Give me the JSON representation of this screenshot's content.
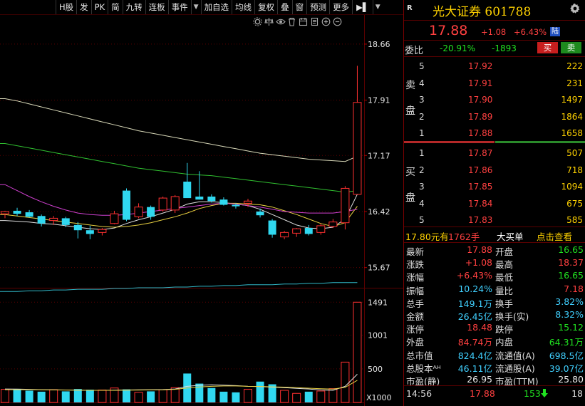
{
  "toolbar": {
    "items": [
      "H股",
      "发",
      "PK",
      "简",
      "九转",
      "连板",
      "事件",
      "",
      "加自选",
      "均线",
      "复权",
      "叠",
      "窗",
      "预测",
      "更多"
    ],
    "tab_arrow": "▶▌",
    "menu_arrow": "▼"
  },
  "chart_tools": [
    "settings-icon",
    "scale-icon",
    "eye-icon",
    "trash-icon",
    "calendar-icon",
    "doc-icon",
    "zoom-in-icon",
    "zoom-out-icon"
  ],
  "chart_data": {
    "type": "candlestick",
    "price_axis": {
      "ticks": [
        18.66,
        17.91,
        17.17,
        16.42,
        15.67
      ],
      "range": [
        15.4,
        19.05
      ]
    },
    "volume_axis": {
      "ticks": [
        1491,
        1001,
        500
      ],
      "unit": "X1000",
      "max": 1600
    },
    "candles": [
      {
        "o": 16.39,
        "h": 16.43,
        "l": 16.33,
        "c": 16.42
      },
      {
        "o": 16.43,
        "h": 16.47,
        "l": 16.36,
        "c": 16.39
      },
      {
        "o": 16.41,
        "h": 16.44,
        "l": 16.34,
        "c": 16.35
      },
      {
        "o": 16.36,
        "h": 16.38,
        "l": 16.22,
        "c": 16.26
      },
      {
        "o": 16.3,
        "h": 16.36,
        "l": 16.24,
        "c": 16.33
      },
      {
        "o": 16.33,
        "h": 16.35,
        "l": 16.21,
        "c": 16.24
      },
      {
        "o": 16.24,
        "h": 16.28,
        "l": 16.06,
        "c": 16.17
      },
      {
        "o": 16.17,
        "h": 16.23,
        "l": 16.05,
        "c": 16.12
      },
      {
        "o": 16.14,
        "h": 16.2,
        "l": 16.1,
        "c": 16.18
      },
      {
        "o": 16.26,
        "h": 16.43,
        "l": 16.25,
        "c": 16.39
      },
      {
        "o": 16.7,
        "h": 16.73,
        "l": 16.29,
        "c": 16.31
      },
      {
        "o": 16.35,
        "h": 16.53,
        "l": 16.33,
        "c": 16.48
      },
      {
        "o": 16.48,
        "h": 16.5,
        "l": 16.31,
        "c": 16.35
      },
      {
        "o": 16.44,
        "h": 16.62,
        "l": 16.42,
        "c": 16.6
      },
      {
        "o": 16.44,
        "h": 16.64,
        "l": 16.4,
        "c": 16.62
      },
      {
        "o": 16.82,
        "h": 17.07,
        "l": 16.68,
        "c": 16.6
      },
      {
        "o": 16.62,
        "h": 16.96,
        "l": 16.58,
        "c": 16.58
      },
      {
        "o": 16.62,
        "h": 16.65,
        "l": 16.54,
        "c": 16.56
      },
      {
        "o": 16.58,
        "h": 16.61,
        "l": 16.5,
        "c": 16.51
      },
      {
        "o": 16.51,
        "h": 16.53,
        "l": 16.46,
        "c": 16.49
      },
      {
        "o": 16.53,
        "h": 16.59,
        "l": 16.48,
        "c": 16.56
      },
      {
        "o": 16.42,
        "h": 16.46,
        "l": 16.34,
        "c": 16.37
      },
      {
        "o": 16.3,
        "h": 16.32,
        "l": 16.07,
        "c": 16.11
      },
      {
        "o": 16.08,
        "h": 16.16,
        "l": 16.05,
        "c": 16.14
      },
      {
        "o": 16.13,
        "h": 16.2,
        "l": 16.08,
        "c": 16.19
      },
      {
        "o": 16.2,
        "h": 16.24,
        "l": 16.1,
        "c": 16.12
      },
      {
        "o": 16.14,
        "h": 16.26,
        "l": 16.11,
        "c": 16.23
      },
      {
        "o": 16.22,
        "h": 16.32,
        "l": 16.2,
        "c": 16.28
      },
      {
        "o": 16.27,
        "h": 16.76,
        "l": 16.18,
        "c": 16.73
      },
      {
        "o": 16.65,
        "h": 18.37,
        "l": 16.65,
        "c": 17.88
      }
    ],
    "volumes": [
      195,
      200,
      175,
      160,
      190,
      165,
      200,
      190,
      185,
      215,
      195,
      150,
      165,
      190,
      220,
      430,
      280,
      215,
      160,
      150,
      195,
      310,
      270,
      180,
      135,
      160,
      170,
      205,
      600,
      1491
    ],
    "ma": [
      {
        "name": "white",
        "color": "#e0e0e0",
        "values": [
          16.3,
          16.29,
          16.28,
          16.26,
          16.25,
          16.23,
          16.21,
          16.19,
          16.18,
          16.2,
          16.26,
          16.31,
          16.35,
          16.4,
          16.45,
          16.52,
          16.55,
          16.55,
          16.54,
          16.52,
          16.5,
          16.45,
          16.38,
          16.31,
          16.24,
          16.2,
          16.19,
          16.21,
          16.32,
          16.65
        ]
      },
      {
        "name": "yellow",
        "color": "#e8d040",
        "values": [
          16.38,
          16.36,
          16.34,
          16.32,
          16.3,
          16.28,
          16.26,
          16.24,
          16.22,
          16.21,
          16.22,
          16.24,
          16.27,
          16.31,
          16.35,
          16.4,
          16.46,
          16.5,
          16.53,
          16.53,
          16.52,
          16.51,
          16.48,
          16.43,
          16.38,
          16.32,
          16.26,
          16.22,
          16.27,
          16.49
        ]
      },
      {
        "name": "magenta",
        "color": "#d040d0",
        "values": [
          16.78,
          16.7,
          16.62,
          16.55,
          16.49,
          16.44,
          16.4,
          16.38,
          16.37,
          16.37,
          16.38,
          16.4,
          16.42,
          16.44,
          16.46,
          16.48,
          16.5,
          16.52,
          16.53,
          16.52,
          16.5,
          16.48,
          16.45,
          16.42,
          16.41,
          16.4,
          16.4,
          16.4,
          16.42,
          16.45
        ]
      },
      {
        "name": "green",
        "color": "#30c030",
        "values": [
          17.33,
          17.3,
          17.27,
          17.24,
          17.21,
          17.18,
          17.15,
          17.12,
          17.09,
          17.06,
          17.03,
          17.0,
          16.98,
          16.96,
          16.94,
          16.92,
          16.91,
          16.9,
          16.88,
          16.86,
          16.84,
          16.82,
          16.8,
          16.78,
          16.76,
          16.74,
          16.72,
          16.7,
          16.68,
          16.7
        ]
      },
      {
        "name": "cream",
        "color": "#d8d8b8",
        "values": [
          17.93,
          17.9,
          17.86,
          17.82,
          17.78,
          17.74,
          17.7,
          17.66,
          17.62,
          17.58,
          17.54,
          17.5,
          17.47,
          17.44,
          17.41,
          17.38,
          17.35,
          17.32,
          17.29,
          17.26,
          17.23,
          17.2,
          17.18,
          17.16,
          17.14,
          17.12,
          17.11,
          17.1,
          17.09,
          17.16
        ]
      },
      {
        "name": "cyan",
        "color": "#30b8c8",
        "values": [
          15.35,
          15.35,
          15.36,
          15.36,
          15.37,
          15.37,
          15.38,
          15.38,
          15.38,
          15.39,
          15.39,
          15.4,
          15.4,
          15.4,
          15.41,
          15.41,
          15.42,
          15.42,
          15.43,
          15.43,
          15.44,
          15.44,
          15.44,
          15.45,
          15.45,
          15.46,
          15.46,
          15.47,
          15.47,
          15.47
        ]
      }
    ],
    "vol_ma": [
      {
        "color": "#e0e0e0",
        "values": [
          200,
          198,
          195,
          190,
          188,
          185,
          182,
          180,
          180,
          182,
          185,
          188,
          190,
          192,
          200,
          240,
          255,
          262,
          258,
          250,
          240,
          235,
          228,
          220,
          210,
          200,
          185,
          180,
          240,
          420
        ]
      },
      {
        "color": "#e8d040",
        "values": [
          190,
          190,
          190,
          188,
          186,
          184,
          182,
          180,
          180,
          180,
          182,
          184,
          186,
          188,
          195,
          215,
          230,
          240,
          245,
          245,
          240,
          238,
          232,
          228,
          220,
          212,
          205,
          198,
          225,
          330
        ]
      }
    ]
  },
  "quote": {
    "r_label": "R",
    "name": "光大证券 601788",
    "price": "17.88",
    "change": "+1.08",
    "pct": "+6.43%",
    "badge": "陆"
  },
  "weibi": {
    "label": "委比",
    "pct": "-20.91%",
    "diff": "-1893",
    "buy_label": "买",
    "sell_label": "卖"
  },
  "sell_book": {
    "label_top": "卖",
    "label_bot": "盘",
    "rows": [
      {
        "lv": "5",
        "price": "17.92",
        "vol": "222"
      },
      {
        "lv": "4",
        "price": "17.91",
        "vol": "231"
      },
      {
        "lv": "3",
        "price": "17.90",
        "vol": "1497"
      },
      {
        "lv": "2",
        "price": "17.89",
        "vol": "1864"
      },
      {
        "lv": "1",
        "price": "17.88",
        "vol": "1658"
      }
    ]
  },
  "buy_book": {
    "label_top": "买",
    "label_bot": "盘",
    "rows": [
      {
        "lv": "1",
        "price": "17.87",
        "vol": "507"
      },
      {
        "lv": "2",
        "price": "17.86",
        "vol": "718"
      },
      {
        "lv": "3",
        "price": "17.85",
        "vol": "1094"
      },
      {
        "lv": "4",
        "price": "17.84",
        "vol": "675"
      },
      {
        "lv": "5",
        "price": "17.83",
        "vol": "585"
      }
    ]
  },
  "big_order": {
    "price": "17.80元有",
    "vol": "1762手",
    "label": "大买单",
    "link": "点击查看"
  },
  "stats": [
    {
      "k1": "最新",
      "v1": "17.88",
      "c1": "up",
      "k2": "开盘",
      "v2": "16.65",
      "c2": "dn"
    },
    {
      "k1": "涨跌",
      "v1": "+1.08",
      "c1": "up",
      "k2": "最高",
      "v2": "18.37",
      "c2": "up"
    },
    {
      "k1": "涨幅",
      "v1": "+6.43%",
      "c1": "up",
      "k2": "最低",
      "v2": "16.65",
      "c2": "dn"
    },
    {
      "k1": "振幅",
      "v1": "10.24%",
      "c1": "cy",
      "k2": "量比",
      "v2": "7.18",
      "c2": "up"
    },
    {
      "k1": "总手",
      "v1": "149.1万",
      "c1": "cy",
      "k2": "换手",
      "v2": "3.82%",
      "c2": "cy"
    },
    {
      "k1": "金额",
      "v1": "26.45亿",
      "c1": "cy",
      "k2": "换手(实)",
      "v2": "8.32%",
      "c2": "cy"
    },
    {
      "k1": "涨停",
      "v1": "18.48",
      "c1": "up",
      "k2": "跌停",
      "v2": "15.12",
      "c2": "dn"
    },
    {
      "k1": "外盘",
      "v1": "84.74万",
      "c1": "up",
      "k2": "内盘",
      "v2": "64.31万",
      "c2": "dn"
    },
    {
      "k1": "总市值",
      "v1": "824.4亿",
      "c1": "cy",
      "k2": "流通值(A)",
      "v2": "698.5亿",
      "c2": "cy"
    },
    {
      "k1": "总股本ᴬᴴ",
      "v1": "46.11亿",
      "c1": "cy",
      "k2": "流通股(A)",
      "v2": "39.07亿",
      "c2": "cy"
    },
    {
      "k1": "市盈(静)",
      "v1": "26.95",
      "c1": "wt",
      "k2": "市盈(TTM)",
      "v2": "25.80",
      "c2": "wt"
    }
  ],
  "tick": {
    "time": "14:56",
    "price": "17.88",
    "vol": "153",
    "n": "18"
  },
  "colors": {
    "up": "#ff4040",
    "down": "#20e020",
    "bull_candle": "#ff3030",
    "bear_candle": "#30d8f0",
    "grid": "#5a0000"
  }
}
